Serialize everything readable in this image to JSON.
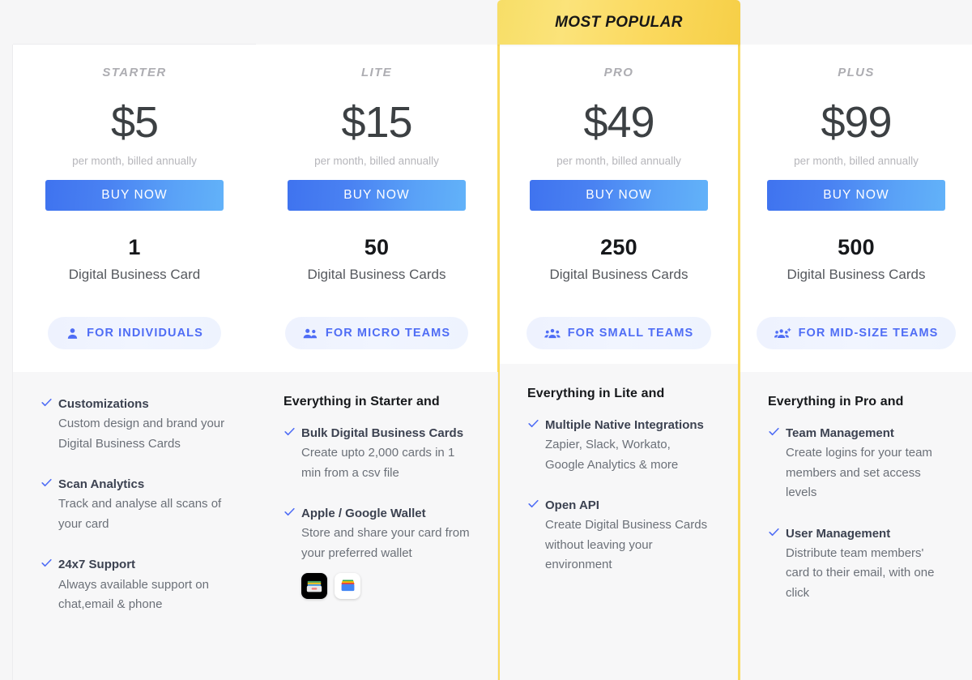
{
  "banner": {
    "label": "MOST POPULAR",
    "color": "#fada5a"
  },
  "accent": {
    "button_start": "#3f73ef",
    "button_end": "#62b2f9",
    "pill_text": "#4f6df5",
    "check": "#4f6df5"
  },
  "buy_label": "BUY NOW",
  "billing_note": "per month, billed annually",
  "plans": [
    {
      "name": "STARTER",
      "price": "$5",
      "billing": "per month, billed annually",
      "buy_label": "BUY NOW",
      "card_count": "1",
      "card_label": "Digital Business Card",
      "audience": "FOR INDIVIDUALS",
      "audience_icon": "single-user-icon",
      "features_heading": "",
      "features": [
        {
          "title": "Customizations",
          "desc": "Custom design and brand your Digital Business Cards"
        },
        {
          "title": "Scan Analytics",
          "desc": "Track and analyse all scans of your card"
        },
        {
          "title": "24x7 Support",
          "desc": "Always available support on chat,email & phone"
        }
      ]
    },
    {
      "name": "LITE",
      "price": "$15",
      "billing": "per month, billed annually",
      "buy_label": "BUY NOW",
      "card_count": "50",
      "card_label": "Digital Business Cards",
      "audience": "FOR MICRO TEAMS",
      "audience_icon": "two-users-icon",
      "features_heading": "Everything in Starter and",
      "features": [
        {
          "title": "Bulk Digital Business Cards",
          "desc": "Create upto 2,000 cards in 1 min from a csv file"
        },
        {
          "title": "Apple / Google Wallet",
          "desc": "Store and share your card from your preferred wallet",
          "wallet_icons": [
            "apple-wallet-icon",
            "google-wallet-icon"
          ]
        }
      ]
    },
    {
      "name": "PRO",
      "price": "$49",
      "billing": "per month, billed annually",
      "buy_label": "BUY NOW",
      "card_count": "250",
      "card_label": "Digital Business Cards",
      "audience": "FOR SMALL TEAMS",
      "audience_icon": "three-users-icon",
      "features_heading": "Everything in Lite and",
      "highlighted": true,
      "features": [
        {
          "title": "Multiple Native Integrations",
          "desc": "Zapier, Slack, Workato, Google Analytics & more"
        },
        {
          "title": "Open API",
          "desc": "Create Digital Business Cards without leaving your environment"
        }
      ]
    },
    {
      "name": "PLUS",
      "price": "$99",
      "billing": "per month, billed annually",
      "buy_label": "BUY NOW",
      "card_count": "500",
      "card_label": "Digital Business Cards",
      "audience": "FOR MID-SIZE TEAMS",
      "audience_icon": "users-plus-icon",
      "features_heading": "Everything in Pro and",
      "features": [
        {
          "title": "Team Management",
          "desc": "Create logins for your team members and set access levels"
        },
        {
          "title": "User Management",
          "desc": "Distribute team members' card to their email, with one click"
        }
      ]
    }
  ]
}
